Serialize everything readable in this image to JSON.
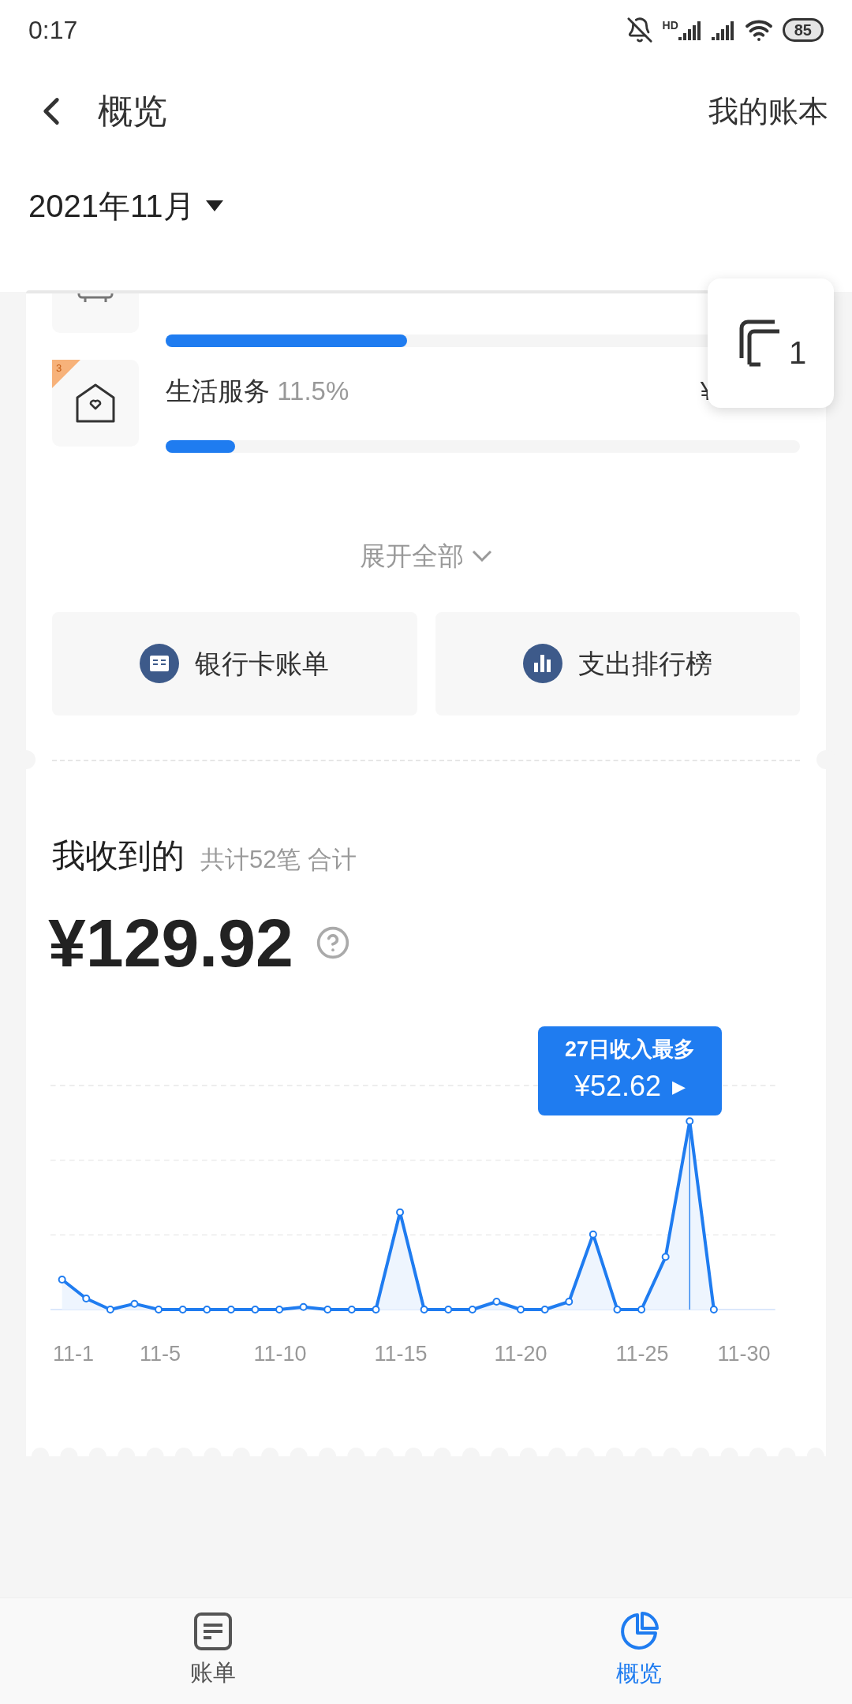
{
  "status_bar": {
    "time": "0:17",
    "network_label": "HD",
    "battery": "85"
  },
  "header": {
    "title": "概览",
    "action": "我的账本"
  },
  "month_picker": {
    "label": "2021年11月"
  },
  "categories": [
    {
      "kind": "bus",
      "level": 0.38
    },
    {
      "kind": "house",
      "rank": "3",
      "name": "生活服务",
      "percent": "11.5%",
      "amount": "¥",
      "level": 0.11
    }
  ],
  "floating_button": {
    "count": "1"
  },
  "expand": {
    "label": "展开全部"
  },
  "shortcuts": [
    {
      "kind": "bank",
      "label": "银行卡账单"
    },
    {
      "kind": "chart",
      "label": "支出排行榜"
    }
  ],
  "income": {
    "title": "我收到的",
    "summary": "共计52笔 合计",
    "total": "¥129.92",
    "tooltip": {
      "title": "27日收入最多",
      "value": "¥52.62",
      "arrow": "▶"
    },
    "x_labels": [
      "11-1",
      "11-5",
      "11-10",
      "11-15",
      "11-20",
      "11-25",
      "11-30"
    ]
  },
  "tabs": [
    {
      "kind": "list",
      "label": "账单",
      "selected": false
    },
    {
      "kind": "pie",
      "label": "概览",
      "selected": true
    }
  ]
}
